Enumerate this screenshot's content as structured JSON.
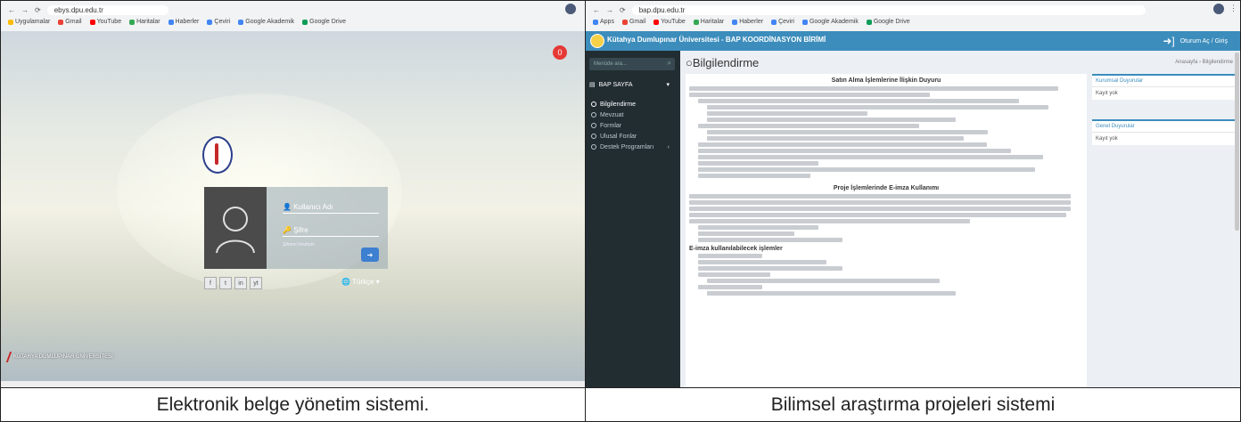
{
  "captions": {
    "left": "Elektronik belge yönetim sistemi.",
    "right": "Bilimsel araştırma projeleri sistemi"
  },
  "left_panel": {
    "browser": {
      "url": "ebys.dpu.edu.tr",
      "bookmarks": [
        "Uygulamalar",
        "Gmail",
        "YouTube",
        "Haritalar",
        "Haberler",
        "Çeviri",
        "Google Akademik",
        "Google Drive"
      ]
    },
    "notification_count": "0",
    "login": {
      "username_label": "Kullanıcı Adı",
      "password_label": "Şifre",
      "forgot": "Şifremi Unuttum",
      "submit_icon": "arrow-right-icon",
      "language": "Türkçe"
    },
    "social_icons": [
      "f",
      "t",
      "in",
      "yt"
    ],
    "footer": "KÜTAHYA DUMLUPINAR ÜNİVERSİTESİ"
  },
  "right_panel": {
    "browser": {
      "url": "bap.dpu.edu.tr",
      "bookmarks": [
        "Apps",
        "Gmail",
        "YouTube",
        "Haritalar",
        "Haberler",
        "Çeviri",
        "Google Akademik",
        "Google Drive"
      ]
    },
    "header": {
      "title": "Kütahya Dumlupınar Üniversitesi - BAP KOORDİNASYON BİRİMİ",
      "login_button": "Oturum Aç / Giriş"
    },
    "sidebar": {
      "search_placeholder": "Menüde ara...",
      "section": "BAP SAYFA",
      "items": [
        "Bilgilendirme",
        "Mevzuat",
        "Formlar",
        "Ulusal Fonlar",
        "Destek Programları"
      ]
    },
    "page_title": "Bilgilendirme",
    "breadcrumb": "Anasayfa › Bilgilendirme",
    "content": {
      "section1_title": "Satın Alma İşlemlerine İlişkin Duyuru",
      "section2_title": "Proje İşlemlerinde E-imza Kullanımı",
      "subsection_title": "E-imza kullanılabilecek işlemler"
    },
    "side_boxes": [
      {
        "title": "Kurumsal Duyurular",
        "value": "Kayıt yok"
      },
      {
        "title": "Genel Duyurular",
        "value": "Kayıt yok"
      }
    ],
    "colors": {
      "header": "#3c8dbc",
      "sidebar": "#222d32"
    }
  }
}
